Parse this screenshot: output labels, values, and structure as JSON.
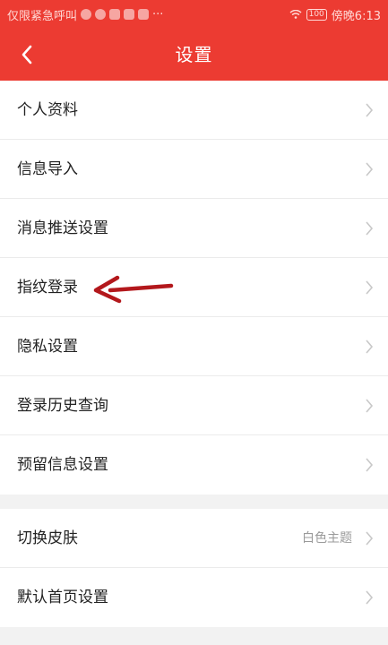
{
  "status_bar": {
    "left_text": "仅限紧急呼叫",
    "more": "···",
    "battery": "100",
    "carrier_time": "傍晚6:13"
  },
  "header": {
    "title": "设置",
    "back_icon": "chevron-left-icon"
  },
  "settings": {
    "group1": [
      {
        "label": "个人资料"
      },
      {
        "label": "信息导入"
      },
      {
        "label": "消息推送设置"
      },
      {
        "label": "指纹登录"
      },
      {
        "label": "隐私设置"
      },
      {
        "label": "登录历史查询"
      },
      {
        "label": "预留信息设置"
      }
    ],
    "group2": [
      {
        "label": "切换皮肤",
        "value": "白色主题"
      },
      {
        "label": "默认首页设置"
      }
    ]
  },
  "colors": {
    "header_bg": "#ec3b32",
    "page_bg": "#f2f2f2",
    "annotation_arrow": "#b3181c"
  }
}
